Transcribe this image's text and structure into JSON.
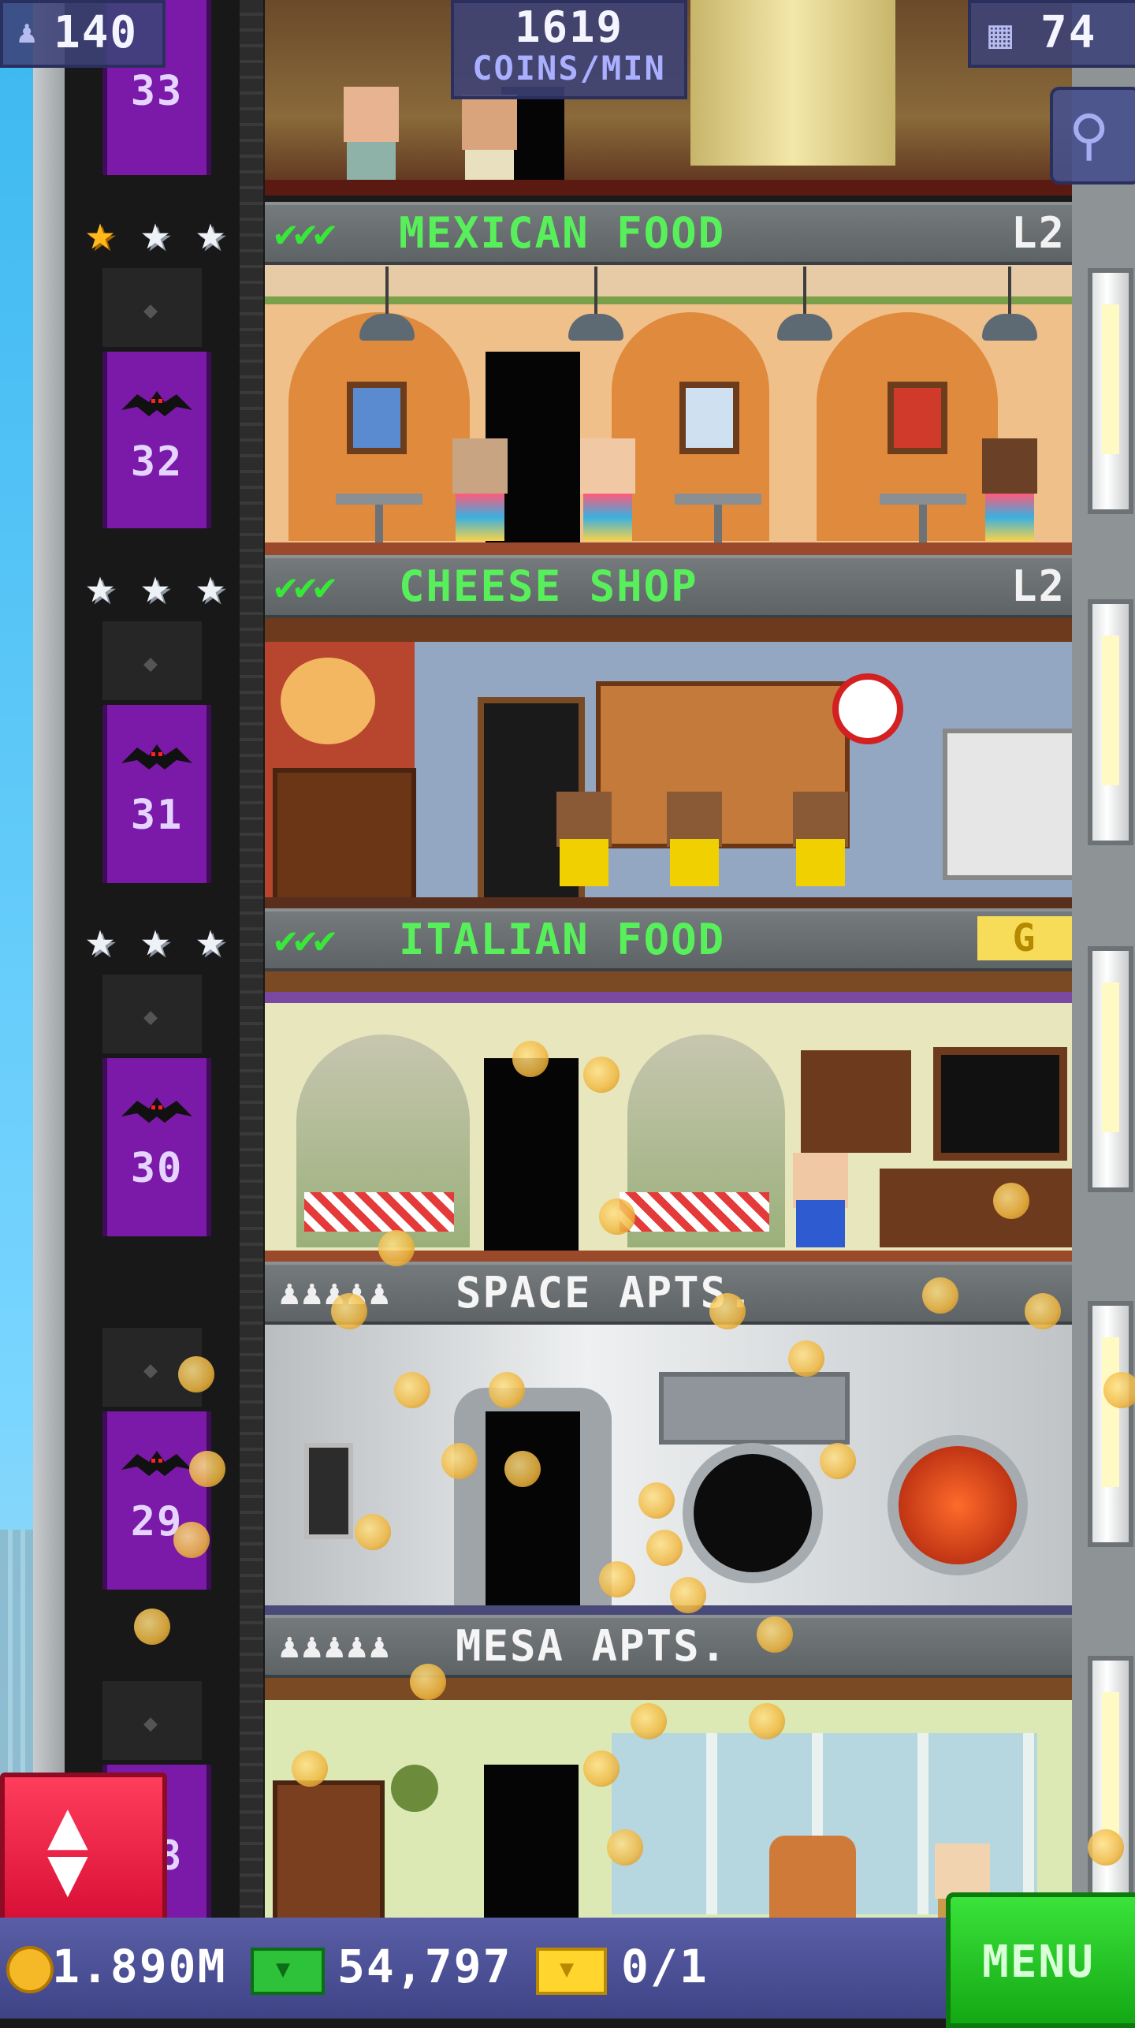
{
  "hud": {
    "population": "140",
    "rate_value": "1619",
    "rate_unit": "COINS/MIN",
    "floors": "74"
  },
  "elevator": {
    "floor_numbers": [
      "33",
      "32",
      "31",
      "30",
      "29",
      "28"
    ]
  },
  "floors": [
    {
      "name": "MEXICAN FOOD",
      "level": "L2",
      "checks": "✔✔✔",
      "stars": [
        "gold",
        "silver",
        "silver"
      ]
    },
    {
      "name": "CHEESE SHOP",
      "level": "L2",
      "checks": "✔✔✔",
      "stars": [
        "silver",
        "silver",
        "silver"
      ]
    },
    {
      "name": "ITALIAN FOOD",
      "badge": "G",
      "checks": "✔✔✔",
      "stars": [
        "silver",
        "silver",
        "silver"
      ]
    },
    {
      "name": "SPACE APTS.",
      "residents": "♟♟♟♟♟"
    },
    {
      "name": "MESA APTS.",
      "residents": "♟♟♟♟♟"
    }
  ],
  "bottom": {
    "coins": "1.890M",
    "bux": "54,797",
    "vip": "0/1",
    "menu_label": "MENU"
  },
  "icons": {
    "population": "person-icon",
    "floors": "building-icon",
    "search": "magnifier-icon",
    "elevator_button": "up-down-arrows-icon",
    "star_gold": "gold-star-icon",
    "star_silver": "silver-star-icon"
  },
  "colors": {
    "banner_text": "#58f05a",
    "elevator": "#7b1aa8",
    "menu": "#1fc21f",
    "elevator_button": "#e8203f"
  }
}
